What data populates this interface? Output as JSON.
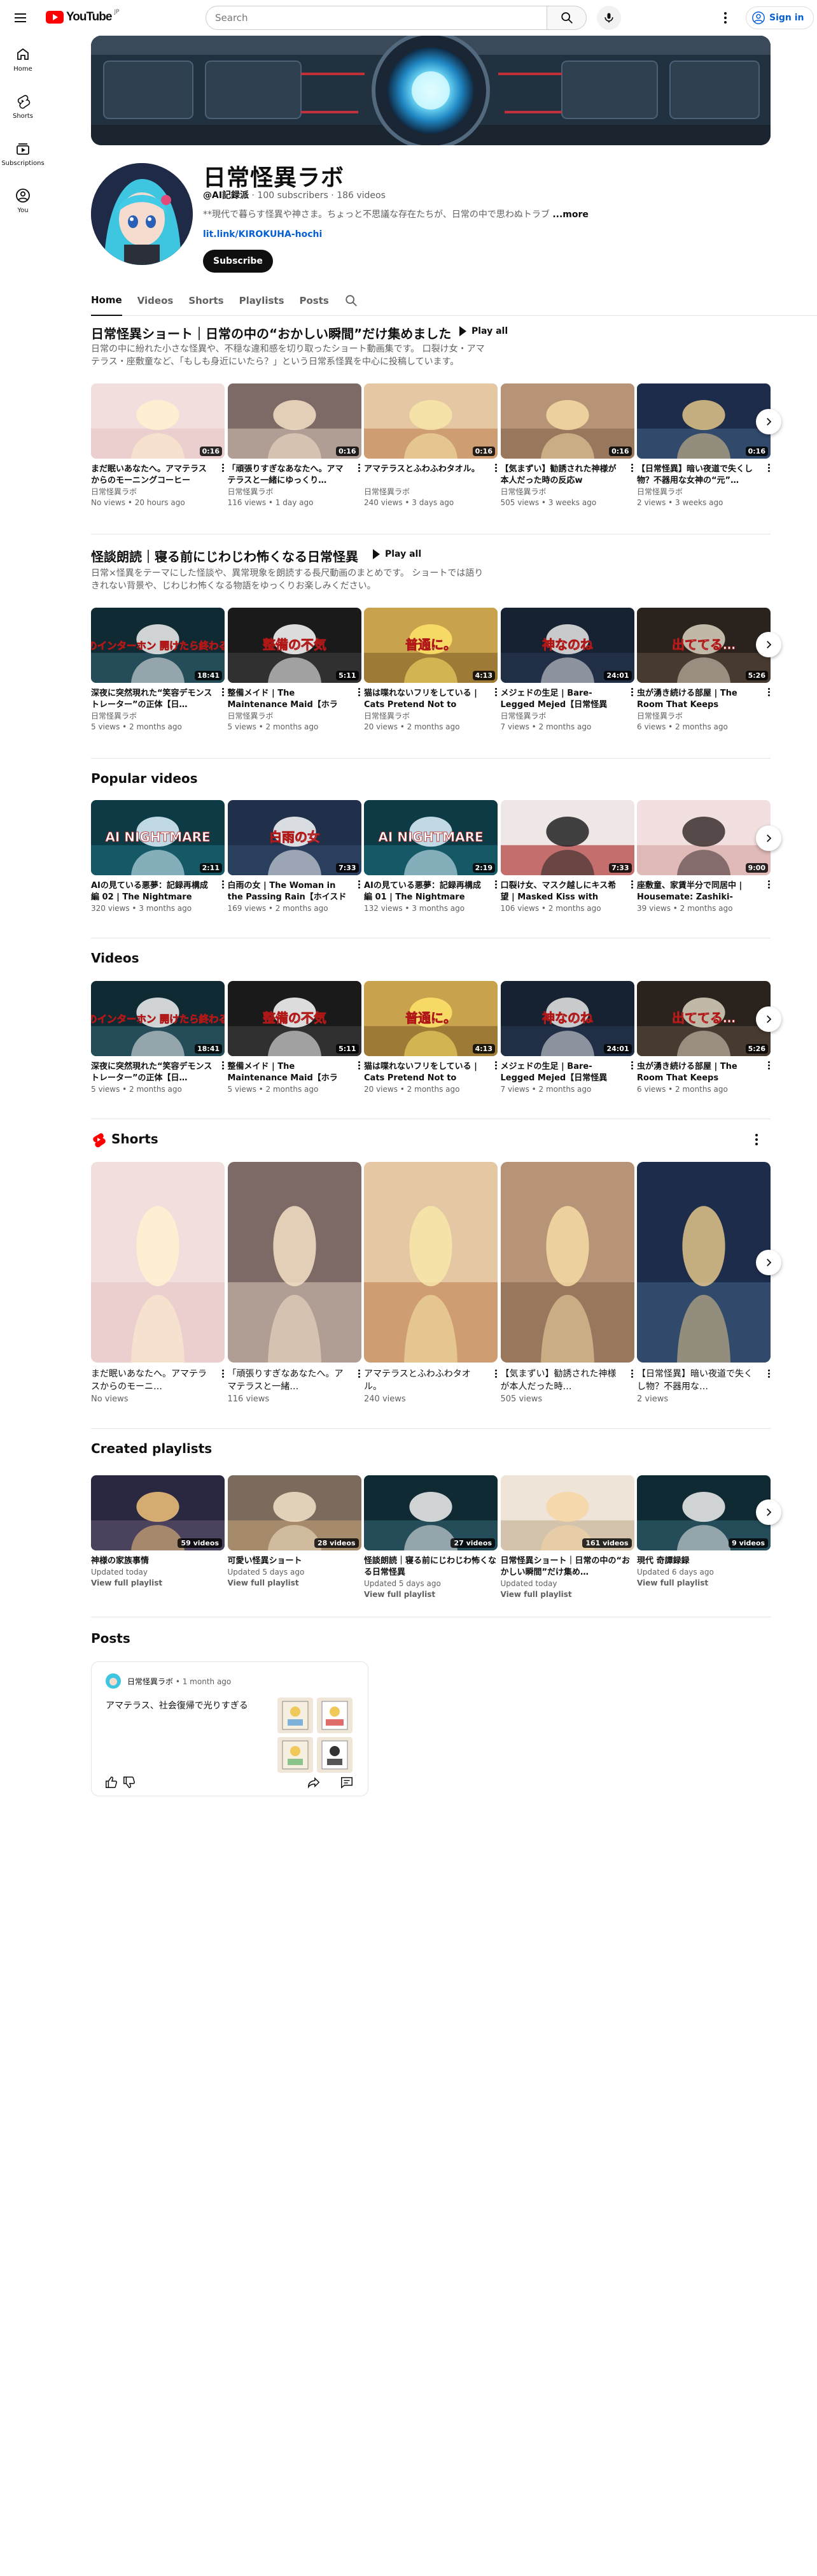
{
  "header": {
    "logo_text": "YouTube",
    "country": "JP",
    "search_placeholder": "Search",
    "signin_label": "Sign in"
  },
  "guide": [
    {
      "label": "Home",
      "icon": "home-icon"
    },
    {
      "label": "Shorts",
      "icon": "shorts-icon"
    },
    {
      "label": "Subscriptions",
      "icon": "subscriptions-icon"
    },
    {
      "label": "You",
      "icon": "you-icon"
    }
  ],
  "channel": {
    "name": "日常怪異ラボ",
    "handle": "@AI記録派",
    "subscribers": "100 subscribers",
    "videos": "186 videos",
    "description": "**現代で暮らす怪異や神さま。ちょっと不思議な存在たちが、日常の中で思わぬトラブ",
    "more_label": "...more",
    "link": "lit.link/KIROKUHA-hochi",
    "subscribe_label": "Subscribe"
  },
  "tabs": [
    "Home",
    "Videos",
    "Shorts",
    "Playlists",
    "Posts"
  ],
  "sections": {
    "shelf1": {
      "title": "日常怪異ショート｜日常の中の“おかしい瞬間”だけ集めました",
      "play_all": "Play all",
      "desc": "日常の中に紛れた小さな怪異や、不穏な違和感を切り取ったショート動画集です。 口裂け女・アマテラス・座敷童など、「もしも身近にいたら？」という日常系怪異を中心に投稿しています。"
    },
    "shelf2": {
      "title": "怪談朗読｜寝る前にじわじわ怖くなる日常怪異",
      "play_all": "Play all",
      "desc": "日常×怪異をテーマにした怪談や、異常現象を朗読する長尺動画のまとめです。 ショートでは語りきれない背景や、じわじわ怖くなる物語をゆっくりお楽しみください。"
    },
    "popular": {
      "title": "Popular videos"
    },
    "videos": {
      "title": "Videos"
    },
    "shorts": {
      "title": "Shorts"
    },
    "playlists": {
      "title": "Created playlists"
    },
    "posts": {
      "title": "Posts"
    }
  },
  "shelf1_videos": [
    {
      "title": "まだ眠いあなたへ。アマテラスからのモーニングコーヒー",
      "channel": "日常怪異ラボ",
      "meta": "No views • 20 hours ago",
      "duration": "0:16",
      "theme": "a"
    },
    {
      "title": "「頑張りすぎなあなたへ。アマテラスと一緒にゆっくり…",
      "channel": "日常怪異ラボ",
      "meta": "116 views • 1 day ago",
      "duration": "0:16",
      "theme": "b"
    },
    {
      "title": "アマテラスとふわふわタオル。",
      "channel": "日常怪異ラボ",
      "meta": "240 views • 3 days ago",
      "duration": "0:16",
      "theme": "c"
    },
    {
      "title": "【気まずい】勧誘された神様が本人だった時の反応w",
      "channel": "日常怪異ラボ",
      "meta": "505 views • 3 weeks ago",
      "duration": "0:16",
      "theme": "d"
    },
    {
      "title": "【日常怪異】暗い夜道で失くし物？不器用な女神の“元”…",
      "channel": "日常怪異ラボ",
      "meta": "2 views • 3 weeks ago",
      "duration": "0:16",
      "theme": "e"
    }
  ],
  "shelf2_videos": [
    {
      "title": "深夜に突然現れた“笑容デモンストレーター”の正体【日…",
      "channel": "日常怪異ラボ",
      "meta": "5 views • 2 months ago",
      "duration": "18:41",
      "theme": "f",
      "overlay": "深夜のインターホン 開けたら終わるドア"
    },
    {
      "title": "整備メイド | The Maintenance Maid【ホラー…",
      "channel": "日常怪異ラボ",
      "meta": "5 views • 2 months ago",
      "duration": "5:11",
      "theme": "g",
      "overlay": "整備の不気"
    },
    {
      "title": "猫は喋れないフリをしている | Cats Pretend Not to Speak…",
      "channel": "日常怪異ラボ",
      "meta": "20 views • 2 months ago",
      "duration": "4:13",
      "theme": "h",
      "overlay": "普通に。"
    },
    {
      "title": "メジェドの生足 | Bare-Legged Mejed【日常怪異 現…",
      "channel": "日常怪異ラボ",
      "meta": "7 views • 2 months ago",
      "duration": "24:01",
      "theme": "i",
      "overlay": "神なのね"
    },
    {
      "title": "虫が湧き続ける部屋 | The Room That Keeps Breeding…",
      "channel": "日常怪異ラボ",
      "meta": "6 views • 2 months ago",
      "duration": "5:26",
      "theme": "j",
      "overlay": "出ててる…"
    }
  ],
  "popular_videos": [
    {
      "title": "AIの見ている悪夢：記録再構成編 02 | The Nightmare the…",
      "meta": "320 views • 3 months ago",
      "duration": "2:11",
      "theme": "k",
      "overlay": "AI NIGHTMARE"
    },
    {
      "title": "白雨の女 | The Woman in the Passing Rain【ホイスドラ…",
      "meta": "169 views • 2 months ago",
      "duration": "7:33",
      "theme": "l",
      "overlay": "白雨の女"
    },
    {
      "title": "AIの見ている悪夢：記録再構成編 01 | The Nightmare the…",
      "meta": "132 views • 3 months ago",
      "duration": "2:19",
      "theme": "k",
      "overlay": "AI NIGHTMARE"
    },
    {
      "title": "口裂け女、マスク越しにキス希望 | Masked Kiss with the…",
      "meta": "106 views • 2 months ago",
      "duration": "7:33",
      "theme": "m",
      "overlay": ""
    },
    {
      "title": "座敷童、家賃半分で同居中 | Housemate: Zashiki-Waras…",
      "meta": "39 views • 2 months ago",
      "duration": "9:00",
      "theme": "n",
      "overlay": ""
    }
  ],
  "videos_list": [
    {
      "title": "深夜に突然現れた“笑容デモンストレーター”の正体【日…",
      "meta": "5 views • 2 months ago",
      "duration": "18:41",
      "theme": "f",
      "overlay": "深夜のインターホン 開けたら終わるドア"
    },
    {
      "title": "整備メイド | The Maintenance Maid【ホラー…",
      "meta": "5 views • 2 months ago",
      "duration": "5:11",
      "theme": "g",
      "overlay": "整備の不気"
    },
    {
      "title": "猫は喋れないフリをしている | Cats Pretend Not to Speak…",
      "meta": "20 views • 2 months ago",
      "duration": "4:13",
      "theme": "h",
      "overlay": "普通に。"
    },
    {
      "title": "メジェドの生足 | Bare-Legged Mejed【日常怪異 現…",
      "meta": "7 views • 2 months ago",
      "duration": "24:01",
      "theme": "i",
      "overlay": "神なのね"
    },
    {
      "title": "虫が湧き続ける部屋 | The Room That Keeps Breeding…",
      "meta": "6 views • 2 months ago",
      "duration": "5:26",
      "theme": "j",
      "overlay": "出ててる…"
    }
  ],
  "shorts": [
    {
      "title": "まだ眠いあなたへ。アマテラスからのモーニ…",
      "meta": "No views",
      "theme": "a"
    },
    {
      "title": "「頑張りすぎなあなたへ。アマテラスと一緒…",
      "meta": "116 views",
      "theme": "b"
    },
    {
      "title": "アマテラスとふわふわタオル。",
      "meta": "240 views",
      "theme": "c"
    },
    {
      "title": "【気まずい】勧誘された神様が本人だった時…",
      "meta": "505 views",
      "theme": "d"
    },
    {
      "title": "【日常怪異】暗い夜道で失くし物？不器用な…",
      "meta": "2 views",
      "theme": "e"
    }
  ],
  "playlists": [
    {
      "title": "神様の家族事情",
      "updated": "Updated today",
      "count": "59 videos",
      "theme": "o",
      "view": "View full playlist"
    },
    {
      "title": "可愛い怪異ショート",
      "updated": "Updated 5 days ago",
      "count": "28 videos",
      "theme": "p",
      "view": "View full playlist"
    },
    {
      "title": "怪談朗読｜寝る前にじわじわ怖くなる日常怪異",
      "updated": "Updated 5 days ago",
      "count": "27 videos",
      "theme": "f",
      "view": "View full playlist"
    },
    {
      "title": "日常怪異ショート｜日常の中の“おかしい瞬間”だけ集め…",
      "updated": "Updated today",
      "count": "161 videos",
      "theme": "q",
      "view": "View full playlist"
    },
    {
      "title": "現代 奇譚録録",
      "updated": "Updated 6 days ago",
      "count": "9 videos",
      "theme": "f",
      "view": "View full playlist"
    }
  ],
  "post": {
    "author": "日常怪異ラボ",
    "time": "• 1 month ago",
    "text": "アマテラス、社会復帰で光りすぎる"
  },
  "colors": {
    "accent": "#ff0000",
    "link": "#065fd4",
    "text": "#0f0f0f",
    "secondary": "#606060"
  }
}
